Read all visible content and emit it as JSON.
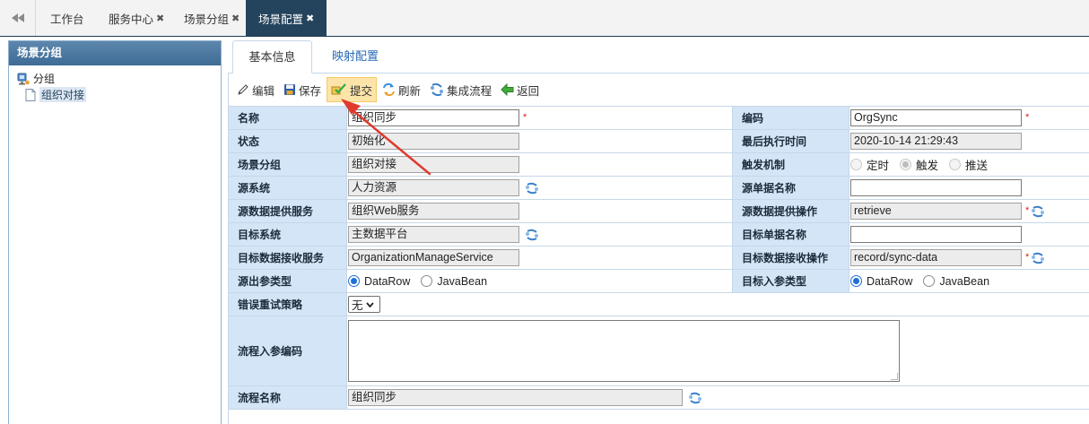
{
  "top_tabs": [
    {
      "label": "工作台",
      "closable": false
    },
    {
      "label": "服务中心",
      "closable": true
    },
    {
      "label": "场景分组",
      "closable": true
    },
    {
      "label": "场景配置",
      "closable": true,
      "active": true
    }
  ],
  "close_glyph": "✖",
  "sidebar": {
    "title": "场景分组",
    "tree": {
      "root": "分组",
      "children": [
        "组织对接"
      ]
    }
  },
  "content_tabs": {
    "basic": "基本信息",
    "mapping": "映射配置"
  },
  "toolbar": {
    "edit": "编辑",
    "save": "保存",
    "submit": "提交",
    "refresh": "刷新",
    "flow": "集成流程",
    "back": "返回"
  },
  "form": {
    "name": {
      "label": "名称",
      "value": "组织同步"
    },
    "code": {
      "label": "编码",
      "value": "OrgSync"
    },
    "status": {
      "label": "状态",
      "value": "初始化"
    },
    "last_exec": {
      "label": "最后执行时间",
      "value": "2020-10-14 21:29:43"
    },
    "group": {
      "label": "场景分组",
      "value": "组织对接"
    },
    "trigger": {
      "label": "触发机制",
      "options": [
        "定时",
        "触发",
        "推送"
      ],
      "selected": "触发"
    },
    "source_system": {
      "label": "源系统",
      "value": "人力资源"
    },
    "source_doc": {
      "label": "源单据名称",
      "value": ""
    },
    "source_service": {
      "label": "源数据提供服务",
      "value": "组织Web服务"
    },
    "source_op": {
      "label": "源数据提供操作",
      "value": "retrieve"
    },
    "target_system": {
      "label": "目标系统",
      "value": "主数据平台"
    },
    "target_doc": {
      "label": "目标单据名称",
      "value": ""
    },
    "target_service": {
      "label": "目标数据接收服务",
      "value": "OrganizationManageService"
    },
    "target_op": {
      "label": "目标数据接收操作",
      "value": "record/sync-data"
    },
    "out_param": {
      "label": "源出参类型",
      "options": [
        "DataRow",
        "JavaBean"
      ],
      "selected": "DataRow"
    },
    "in_param": {
      "label": "目标入参类型",
      "options": [
        "DataRow",
        "JavaBean"
      ],
      "selected": "DataRow"
    },
    "retry": {
      "label": "错误重试策略",
      "value": "无"
    },
    "flow_param": {
      "label": "流程入参编码",
      "value": ""
    },
    "flow_name": {
      "label": "流程名称",
      "value": "组织同步"
    }
  },
  "required_mark": "*",
  "colors": {
    "active_tab": "#24435c",
    "label_bg": "#d4e5f7",
    "highlight": "#fde4a8",
    "annotation_arrow": "#e03a2e",
    "radio_accent": "#1f6fd6"
  }
}
